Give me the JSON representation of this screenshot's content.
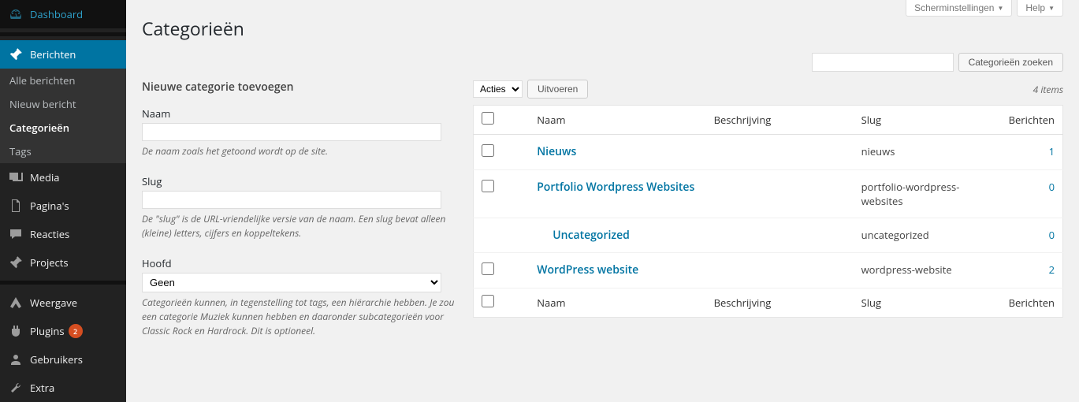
{
  "screen_meta": {
    "options_label": "Scherminstellingen",
    "help_label": "Help"
  },
  "page_title": "Categorieën",
  "sidebar": {
    "items": [
      {
        "id": "dashboard",
        "label": "Dashboard"
      },
      {
        "id": "berichten",
        "label": "Berichten",
        "current": true
      },
      {
        "id": "media",
        "label": "Media"
      },
      {
        "id": "paginas",
        "label": "Pagina's"
      },
      {
        "id": "reacties",
        "label": "Reacties"
      },
      {
        "id": "projects",
        "label": "Projects"
      },
      {
        "id": "weergave",
        "label": "Weergave"
      },
      {
        "id": "plugins",
        "label": "Plugins",
        "badge": "2"
      },
      {
        "id": "gebruikers",
        "label": "Gebruikers"
      },
      {
        "id": "extra",
        "label": "Extra"
      }
    ],
    "sub_items": [
      {
        "id": "alle-berichten",
        "label": "Alle berichten"
      },
      {
        "id": "nieuw-bericht",
        "label": "Nieuw bericht"
      },
      {
        "id": "categorieen",
        "label": "Categorieën",
        "current": true
      },
      {
        "id": "tags",
        "label": "Tags"
      }
    ]
  },
  "search": {
    "button_label": "Categorieën zoeken"
  },
  "form": {
    "heading": "Nieuwe categorie toevoegen",
    "name_label": "Naam",
    "name_desc": "De naam zoals het getoond wordt op de site.",
    "slug_label": "Slug",
    "slug_desc": "De \"slug\" is de URL-vriendelijke versie van de naam. Een slug bevat alleen (kleine) letters, cijfers en koppeltekens.",
    "parent_label": "Hoofd",
    "parent_option": "Geen",
    "parent_desc": "Categorieën kunnen, in tegenstelling tot tags, een hiërarchie hebben. Je zou een categorie Muziek kunnen hebben en daaronder subcategorieën voor Classic Rock en Hardrock. Dit is optioneel."
  },
  "bulk": {
    "actions_label": "Acties",
    "apply_label": "Uitvoeren"
  },
  "table": {
    "items_count": "4 items",
    "cols": {
      "name": "Naam",
      "desc": "Beschrijving",
      "slug": "Slug",
      "posts": "Berichten"
    },
    "rows": [
      {
        "name": "Nieuws",
        "desc": "",
        "slug": "nieuws",
        "posts": "1",
        "cb": true,
        "indent": false
      },
      {
        "name": "Portfolio Wordpress Websites",
        "desc": "",
        "slug": "portfolio-wordpress-websites",
        "posts": "0",
        "cb": true,
        "indent": false
      },
      {
        "name": "Uncategorized",
        "desc": "",
        "slug": "uncategorized",
        "posts": "0",
        "cb": false,
        "indent": true
      },
      {
        "name": "WordPress website",
        "desc": "",
        "slug": "wordpress-website",
        "posts": "2",
        "cb": true,
        "indent": false
      }
    ]
  }
}
